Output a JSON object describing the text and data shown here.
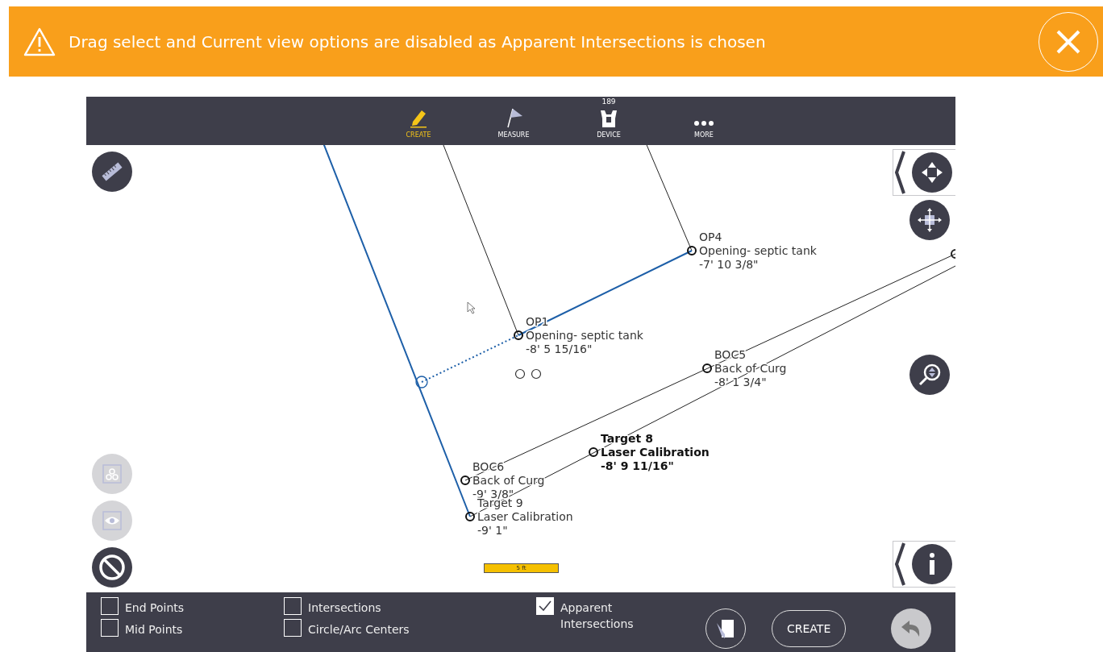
{
  "banner": {
    "message": "Drag select and Current view options are disabled as Apparent Intersections is chosen"
  },
  "nav": [
    {
      "label": "CREATE",
      "selected": true
    },
    {
      "label": "MEASURE",
      "selected": false
    },
    {
      "label": "DEVICE",
      "selected": false,
      "badge": "189"
    },
    {
      "label": "MORE",
      "selected": false
    }
  ],
  "points": [
    {
      "name": "OP4",
      "description": "Opening- septic tank",
      "elevation": "-7' 10 3/8\"",
      "emphasized": false
    },
    {
      "name": "OP1",
      "description": "Opening- septic tank",
      "elevation": "-8' 5 15/16\"",
      "emphasized": false
    },
    {
      "name": "BOC5",
      "description": "Back of Curg",
      "elevation": "-8' 1 3/4\"",
      "emphasized": false
    },
    {
      "name": "Target 8",
      "description": "Laser Calibration",
      "elevation": "-8' 9 11/16\"",
      "emphasized": true
    },
    {
      "name": "BOC6",
      "description": "Back of Curg",
      "elevation": "-9' 3/8\"",
      "emphasized": false
    },
    {
      "name": "Target 9",
      "description": "Laser Calibration",
      "elevation": "-9' 1\"",
      "emphasized": false
    }
  ],
  "scale_bar": {
    "label": "5 ft"
  },
  "left_tools": [
    {
      "kind": "ruler",
      "disabled": false
    },
    {
      "kind": "group",
      "disabled": true
    },
    {
      "kind": "view",
      "disabled": true
    },
    {
      "kind": "cancel",
      "disabled": false
    }
  ],
  "snaps": [
    {
      "label": "End Points",
      "checked": false
    },
    {
      "label": "Intersections",
      "checked": false
    },
    {
      "label": "Apparent Intersections",
      "checked": true
    },
    {
      "label": "Mid Points",
      "checked": false
    },
    {
      "label": "Circle/Arc Centers",
      "checked": false
    }
  ],
  "actions": {
    "create": "CREATE",
    "undo_disabled": true
  }
}
